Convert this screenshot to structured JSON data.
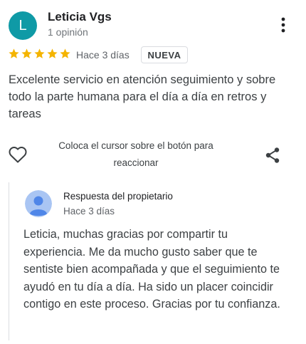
{
  "reviewer": {
    "initial": "L",
    "name": "Leticia Vgs",
    "review_count": "1 opinión",
    "avatar_color": "#0f9aa6"
  },
  "rating": {
    "stars": 5,
    "max": 5,
    "color": "#f4b400"
  },
  "review": {
    "date": "Hace 3 días",
    "badge": "NUEVA",
    "text": "Excelente servicio en atención seguimiento y sobre todo la parte humana para el día a día en retros y tareas"
  },
  "actions": {
    "react_hint": "Coloca el cursor sobre el botón para reaccionar",
    "like_icon": "heart-icon",
    "share_icon": "share-icon",
    "menu_icon": "more-vert-icon"
  },
  "owner_reply": {
    "label": "Respuesta del propietario",
    "date": "Hace 3 días",
    "text": "Leticia, muchas gracias por compartir tu experiencia. Me da mucho gusto saber que te sentiste bien acompañada y que el seguimiento te ayudó en tu día a día. Ha sido un placer coincidir contigo en este proceso. Gracias por tu confianza.",
    "avatar_color": "#a9c5f3"
  }
}
